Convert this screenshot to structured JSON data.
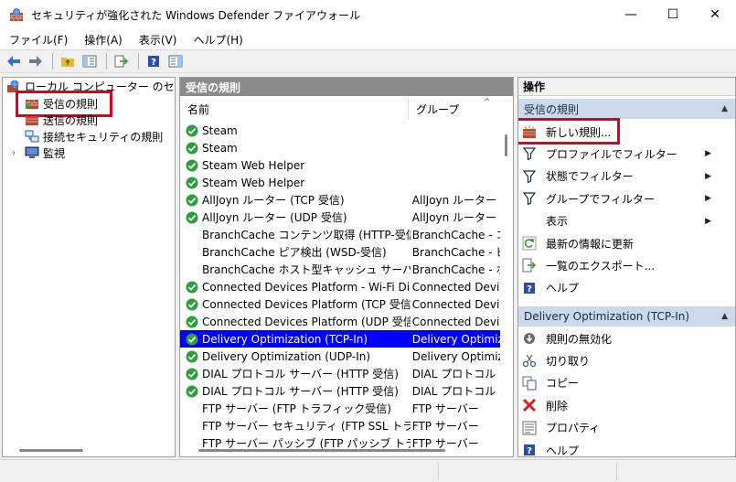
{
  "window": {
    "title": "セキュリティが強化された Windows Defender ファイアウォール",
    "minimize": "—",
    "maximize": "☐",
    "close": "✕"
  },
  "menu": [
    "ファイル(F)",
    "操作(A)",
    "表示(V)",
    "ヘルプ(H)"
  ],
  "toolbar_icons": [
    "back-arrow-icon",
    "forward-arrow-icon",
    "folder-up-icon",
    "show-hide-tree-icon",
    "export-list-icon",
    "help-icon",
    "show-hide-action-pane-icon"
  ],
  "tree": {
    "root": "ローカル コンピューター のセキュリティ",
    "items": [
      "受信の規則",
      "送信の規則",
      "接続セキュリティの規則",
      "監視"
    ]
  },
  "list": {
    "header": "受信の規則",
    "columns": [
      "名前",
      "グループ"
    ],
    "rows": [
      {
        "name": "Steam",
        "group": "",
        "enabled": true
      },
      {
        "name": "Steam",
        "group": "",
        "enabled": true
      },
      {
        "name": "Steam Web Helper",
        "group": "",
        "enabled": true
      },
      {
        "name": "Steam Web Helper",
        "group": "",
        "enabled": true
      },
      {
        "name": "AllJoyn ルーター (TCP 受信)",
        "group": "AllJoyn ルーター",
        "enabled": true
      },
      {
        "name": "AllJoyn ルーター (UDP 受信)",
        "group": "AllJoyn ルーター",
        "enabled": true
      },
      {
        "name": "BranchCache コンテンツ取得 (HTTP-受信)",
        "group": "BranchCache - コ",
        "enabled": false
      },
      {
        "name": "BranchCache ピア検出 (WSD-受信)",
        "group": "BranchCache - ピ",
        "enabled": false
      },
      {
        "name": "BranchCache ホスト型キャッシュ サーバー (HT...",
        "group": "BranchCache - ホ",
        "enabled": false
      },
      {
        "name": "Connected Devices Platform - Wi-Fi Direc...",
        "group": "Connected Devic",
        "enabled": true
      },
      {
        "name": "Connected Devices Platform (TCP 受信)",
        "group": "Connected Devic",
        "enabled": true
      },
      {
        "name": "Connected Devices Platform (UDP 受信)",
        "group": "Connected Devic",
        "enabled": true
      },
      {
        "name": "Delivery Optimization (TCP-In)",
        "group": "Delivery Optimiza",
        "enabled": true,
        "selected": true
      },
      {
        "name": "Delivery Optimization (UDP-In)",
        "group": "Delivery Optimiza",
        "enabled": true
      },
      {
        "name": "DIAL プロトコル サーバー (HTTP 受信)",
        "group": "DIAL プロトコル サ",
        "enabled": true
      },
      {
        "name": "DIAL プロトコル サーバー (HTTP 受信)",
        "group": "DIAL プロトコル サ",
        "enabled": true
      },
      {
        "name": "FTP サーバー (FTP トラフィック受信)",
        "group": "FTP サーバー",
        "enabled": false
      },
      {
        "name": "FTP サーバー セキュリティ (FTP SSL トラフィック...",
        "group": "FTP サーバー",
        "enabled": false
      },
      {
        "name": "FTP サーバー パッシブ (FTP パッシブ トラフィック...",
        "group": "FTP サーバー",
        "enabled": false
      }
    ]
  },
  "ops": {
    "header": "操作",
    "section1": "受信の規則",
    "section1_items": [
      {
        "label": "新しい規則...",
        "icon": "new-rule-icon"
      },
      {
        "label": "プロファイルでフィルター",
        "icon": "filter-icon",
        "submenu": true
      },
      {
        "label": "状態でフィルター",
        "icon": "filter-icon",
        "submenu": true
      },
      {
        "label": "グループでフィルター",
        "icon": "filter-icon",
        "submenu": true
      },
      {
        "label": "表示",
        "icon": "",
        "submenu": true
      },
      {
        "label": "最新の情報に更新",
        "icon": "refresh-icon"
      },
      {
        "label": "一覧のエクスポート...",
        "icon": "export-icon"
      },
      {
        "label": "ヘルプ",
        "icon": "help-icon"
      }
    ],
    "section2": "Delivery Optimization (TCP-In)",
    "section2_items": [
      {
        "label": "規則の無効化",
        "icon": "disable-rule-icon"
      },
      {
        "label": "切り取り",
        "icon": "cut-icon"
      },
      {
        "label": "コピー",
        "icon": "copy-icon"
      },
      {
        "label": "削除",
        "icon": "delete-icon"
      },
      {
        "label": "プロパティ",
        "icon": "properties-icon"
      },
      {
        "label": "ヘルプ",
        "icon": "help-icon"
      }
    ]
  },
  "colors": {
    "selection": "#0000ff",
    "highlight_box": "#e0001a",
    "section_bg": "#cbd9ea",
    "check_green": "#2e9e3a"
  }
}
